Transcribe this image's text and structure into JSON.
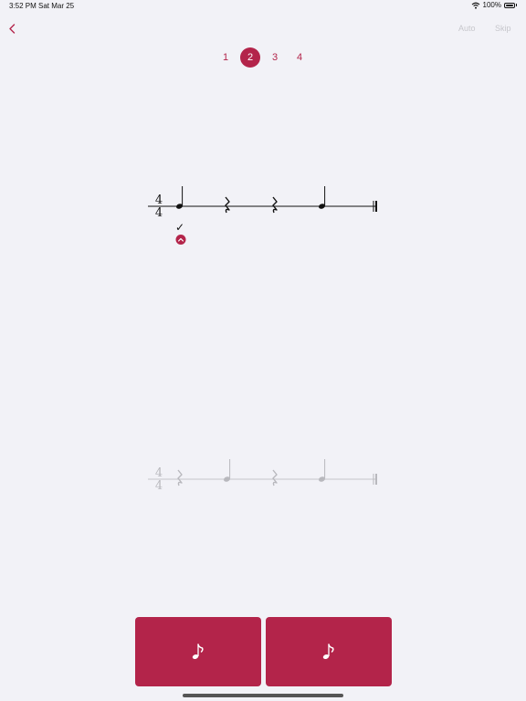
{
  "status_bar": {
    "time": "3:52 PM",
    "date": "Sat Mar 25",
    "battery": "100%"
  },
  "toolbar": {
    "auto_label": "Auto",
    "skip_label": "Skip"
  },
  "steps": [
    "1",
    "2",
    "3",
    "4"
  ],
  "current_step": 2,
  "colors": {
    "accent": "#b3244a",
    "background": "#f2f2f7",
    "muted": "#c7c7cc"
  },
  "rhythm_top": {
    "time_signature": {
      "top": "4",
      "bottom": "4"
    },
    "beats": [
      "quarter-note",
      "quarter-rest",
      "quarter-rest",
      "quarter-note"
    ],
    "feedback": {
      "mark": "✓",
      "expand_icon": "chevron-up-icon"
    }
  },
  "rhythm_bottom": {
    "time_signature": {
      "top": "4",
      "bottom": "4"
    },
    "beats": [
      "quarter-rest",
      "quarter-note",
      "quarter-rest",
      "quarter-note"
    ]
  },
  "answer_buttons": [
    {
      "icon": "eighth-note-icon"
    },
    {
      "icon": "eighth-note-icon"
    }
  ]
}
